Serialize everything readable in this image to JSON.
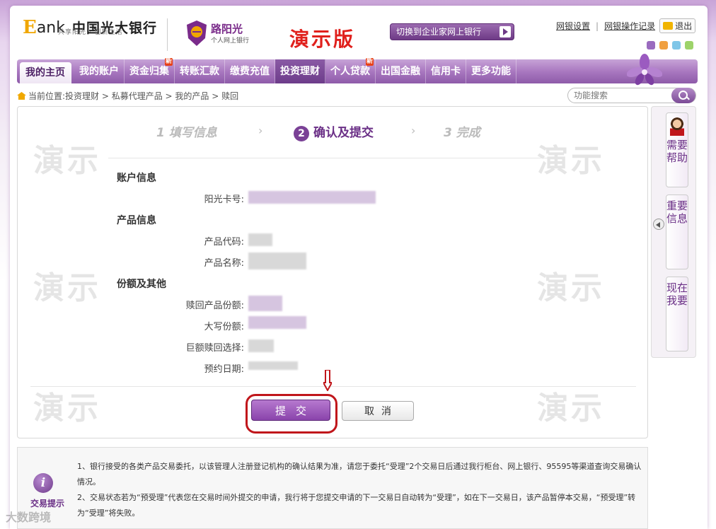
{
  "header": {
    "logo_e": "E",
    "logo_ank": "ank",
    "bank_name": "中国光大银行",
    "slogan": "共享阳光 · 创新生活",
    "sunshine_name": "路阳光",
    "sunshine_sub": "个人网上银行",
    "demo_title": "演示版",
    "switch_label": "切换到企业家网上银行",
    "link_settings": "网银设置",
    "link_records": "网银操作记录",
    "logout": "退出",
    "swatch_colors": [
      "#9a6bbf",
      "#f0a040",
      "#7fc6e8",
      "#9dd36a"
    ]
  },
  "nav": {
    "items": [
      {
        "label": "我的主页",
        "badge": ""
      },
      {
        "label": "我的账户",
        "badge": ""
      },
      {
        "label": "资金归集",
        "badge": "新"
      },
      {
        "label": "转账汇款",
        "badge": ""
      },
      {
        "label": "缴费充值",
        "badge": ""
      },
      {
        "label": "投资理财",
        "badge": ""
      },
      {
        "label": "个人贷款",
        "badge": "新"
      },
      {
        "label": "出国金融",
        "badge": ""
      },
      {
        "label": "信用卡",
        "badge": ""
      },
      {
        "label": "更多功能",
        "badge": ""
      }
    ]
  },
  "breadcrumb": {
    "prefix": "当前位置:",
    "path": "投资理财 > 私募代理产品 > 我的产品 > 赎回"
  },
  "search": {
    "placeholder": "功能搜索"
  },
  "steps": [
    {
      "label": "1 填写信息"
    },
    {
      "num": "2",
      "label": "确认及提交"
    },
    {
      "label": "3 完成"
    }
  ],
  "watermark": "演示",
  "form": {
    "sections": {
      "account": "账户信息",
      "product": "产品信息",
      "share": "份额及其他"
    },
    "fields": {
      "card_no": "阳光卡号:",
      "product_code": "产品代码:",
      "product_name": "产品名称:",
      "redeem_share": "赎回产品份额:",
      "share_upper": "大写份额:",
      "large_redeem": "巨额赎回选择:",
      "reserve_date": "预约日期:"
    },
    "submit": "提交",
    "cancel": "取消"
  },
  "side": {
    "help": "需要帮助",
    "important": "重要信息",
    "want": "现在我要"
  },
  "tips": {
    "label": "交易提示",
    "line1": "1、银行接受的各类产品交易委托，以该管理人注册登记机构的确认结果为准，请您于委托“受理”2个交易日后通过我行柜台、网上银行、95595等渠道查询交易确认情况。",
    "line2": "2、交易状态若为“预受理”代表您在交易时间外提交的申请，我行将于您提交申请的下一交易日自动转为“受理”，如在下一交易日，该产品暂停本交易，“预受理”转为“受理”将失败。"
  },
  "corner_watermark": "大数跨境"
}
